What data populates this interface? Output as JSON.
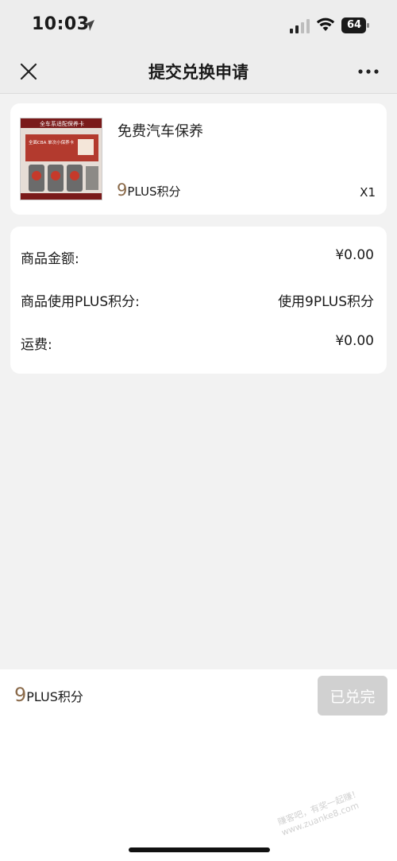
{
  "status_bar": {
    "time": "10:03",
    "battery": "64"
  },
  "nav": {
    "title": "提交兑换申请"
  },
  "product": {
    "name": "免费汽车保养",
    "points_number": "9",
    "points_unit": "PLUS积分",
    "quantity": "X1",
    "image_texts": {
      "header": "全车系适配保养卡",
      "line1": "全面CBA 单次小保养卡"
    }
  },
  "summary": {
    "rows": [
      {
        "label": "商品金额:",
        "value": "¥0.00"
      },
      {
        "label": "商品使用PLUS积分:",
        "value": "使用9PLUS积分"
      },
      {
        "label": "运费:",
        "value": "¥0.00"
      }
    ]
  },
  "footer": {
    "points_number": "9",
    "points_unit": "PLUS积分",
    "button_label": "已兑完"
  },
  "watermark": {
    "line1": "赚客吧，有奖一起赚！",
    "line2": "www.zuanke8.com"
  },
  "colors": {
    "accent_points": "#8a6a4a",
    "disabled_button": "#d1d1d1",
    "background": "#f2f2f2"
  }
}
